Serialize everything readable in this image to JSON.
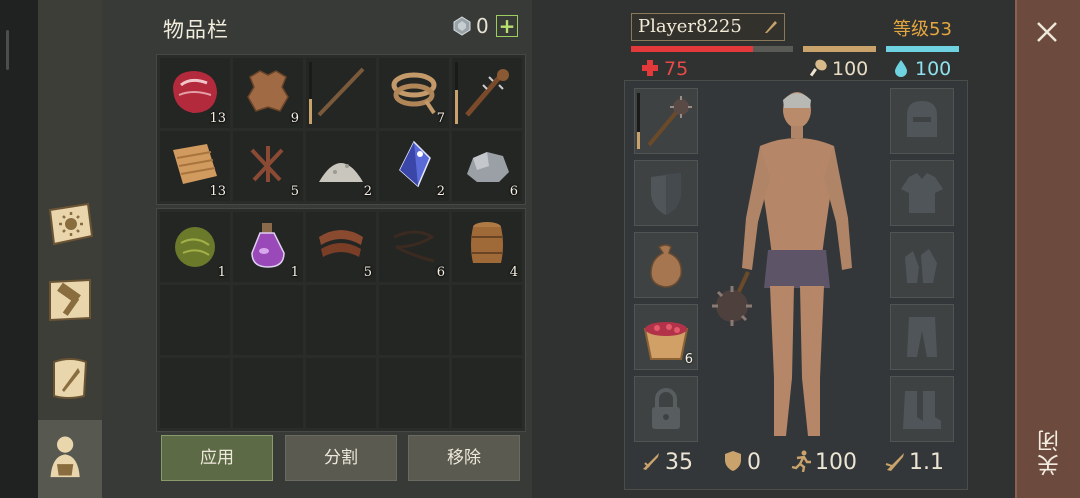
{
  "inventory": {
    "title": "物品栏",
    "gem_count": "0",
    "add_label": "+",
    "backpack": [
      {
        "icon": "raw-meat-icon",
        "count": "13"
      },
      {
        "icon": "leather-hide-icon",
        "count": "9"
      },
      {
        "icon": "wooden-staff-icon",
        "count": "",
        "durability": 0.4
      },
      {
        "icon": "rope-icon",
        "count": "7"
      },
      {
        "icon": "spiked-club-icon",
        "count": "",
        "durability": 0.55
      },
      {
        "icon": "cloth-icon",
        "count": "13"
      },
      {
        "icon": "nails-icon",
        "count": "5"
      },
      {
        "icon": "sand-pile-icon",
        "count": "2"
      },
      {
        "icon": "crystal-icon",
        "count": "2"
      },
      {
        "icon": "stone-icon",
        "count": "6"
      }
    ],
    "pocket": [
      {
        "icon": "herb-ball-icon",
        "count": "1"
      },
      {
        "icon": "potion-icon",
        "count": "1"
      },
      {
        "icon": "leather-strip-icon",
        "count": "5"
      },
      {
        "icon": "fiber-coil-icon",
        "count": "6"
      },
      {
        "icon": "barrel-icon",
        "count": "4"
      },
      {
        "icon": "",
        "count": ""
      },
      {
        "icon": "",
        "count": ""
      },
      {
        "icon": "",
        "count": ""
      },
      {
        "icon": "",
        "count": ""
      },
      {
        "icon": "",
        "count": ""
      },
      {
        "icon": "",
        "count": ""
      },
      {
        "icon": "",
        "count": ""
      },
      {
        "icon": "",
        "count": ""
      },
      {
        "icon": "",
        "count": ""
      },
      {
        "icon": "",
        "count": ""
      }
    ],
    "buttons": {
      "apply": "应用",
      "split": "分割",
      "remove": "移除"
    }
  },
  "player": {
    "name": "Player8225",
    "level": "等级53",
    "health": "75",
    "hunger": "100",
    "thirst": "100",
    "health_fill": 0.75,
    "hunger_fill": 1.0,
    "thirst_fill": 1.0
  },
  "equipment": {
    "weapon_durability": 0.3,
    "bag_count": "6"
  },
  "stats": {
    "attack": "35",
    "defense": "0",
    "speed": "100",
    "weight": "1.1"
  },
  "close_label": "关闭",
  "colors": {
    "health": "#e3393a",
    "hunger": "#c9a36b",
    "thirst": "#6fd2e0",
    "level": "#e4a641",
    "accent_green": "#9fcc60"
  }
}
